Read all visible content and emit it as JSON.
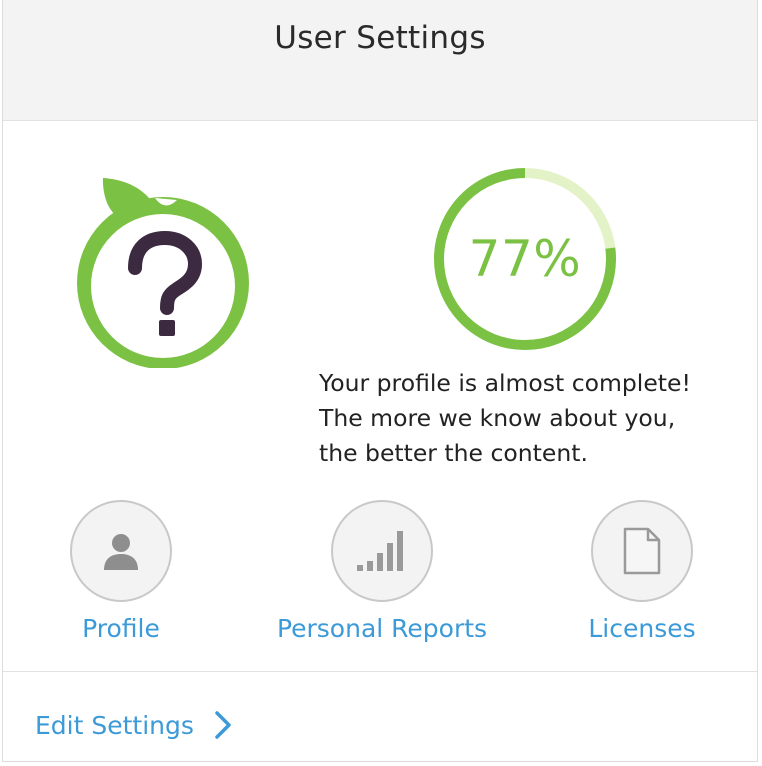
{
  "header": {
    "title": "User Settings"
  },
  "avatar": {
    "icon": "question-apple-icon",
    "brand_color": "#7bc143"
  },
  "profile_progress": {
    "percent": 77,
    "label": "77%",
    "track_color": "#e4f2c7",
    "fill_color": "#7bc143"
  },
  "message": {
    "line1": "Your profile is almost complete!",
    "line2": "The more we know about you,",
    "line3": "the better the content."
  },
  "shortcuts": [
    {
      "label": "Profile",
      "icon": "user-icon"
    },
    {
      "label": "Personal Reports",
      "icon": "bar-chart-icon"
    },
    {
      "label": "Licenses",
      "icon": "document-icon"
    }
  ],
  "footer": {
    "edit_settings_label": "Edit Settings",
    "icon": "chevron-right-icon"
  },
  "colors": {
    "link": "#3c9ad8",
    "header_bg": "#f3f3f4"
  }
}
